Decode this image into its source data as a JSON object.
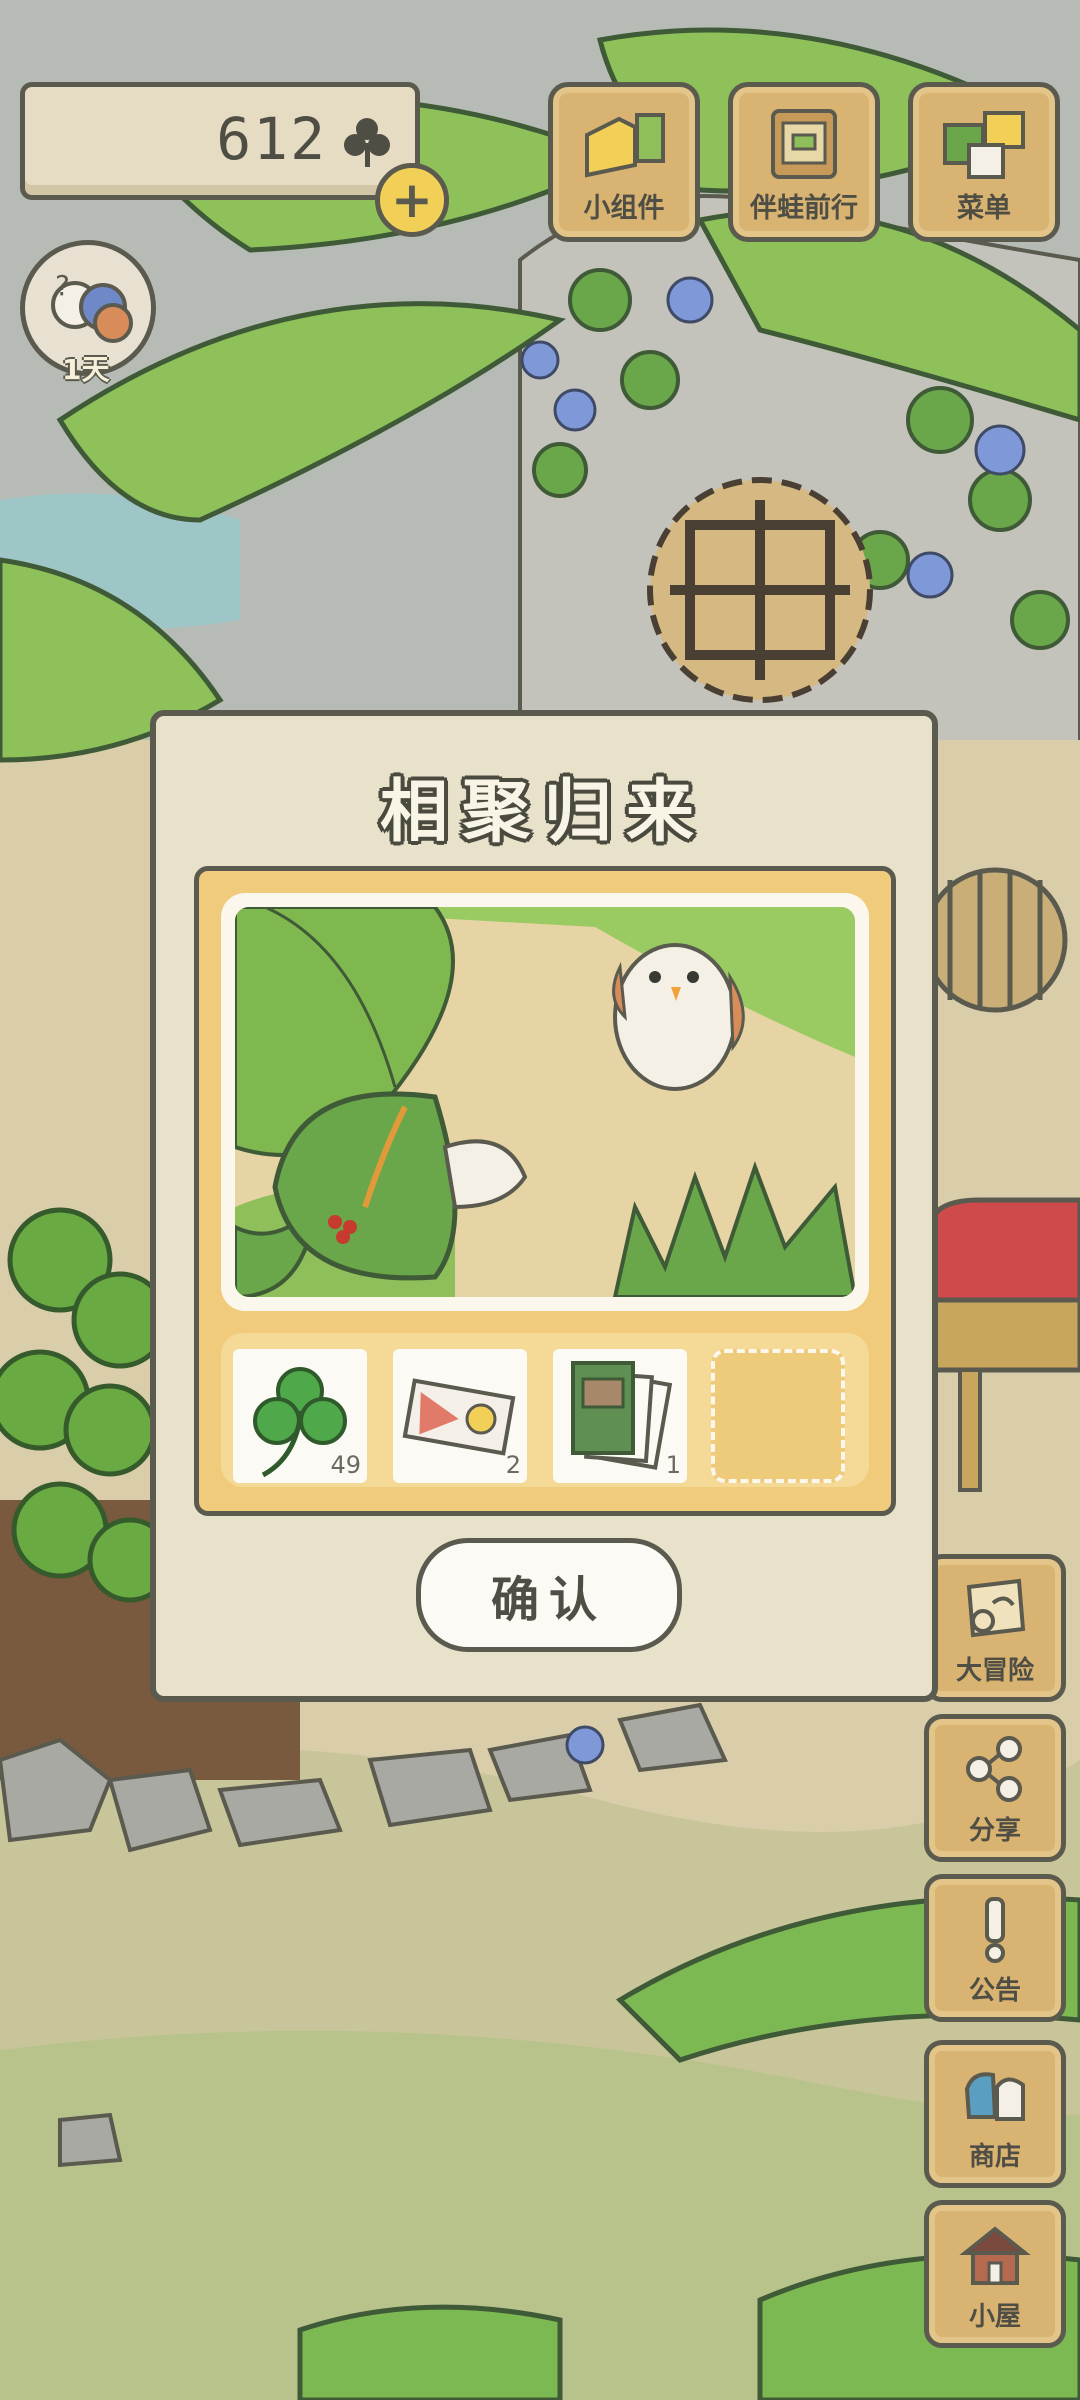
{
  "currency": {
    "count": "612",
    "icon": "clover-icon"
  },
  "album": {
    "day_label": "1天"
  },
  "top_buttons": [
    {
      "label": "小组件",
      "icon": "widget-icon"
    },
    {
      "label": "伴蛙前行",
      "icon": "companion-icon"
    },
    {
      "label": "菜单",
      "icon": "menu-icon"
    }
  ],
  "side_buttons": [
    {
      "label": "大冒险",
      "icon": "adventure-map-icon"
    },
    {
      "label": "分享",
      "icon": "share-icon"
    },
    {
      "label": "公告",
      "icon": "notice-icon"
    },
    {
      "label": "商店",
      "icon": "shop-icon"
    },
    {
      "label": "小屋",
      "icon": "house-icon"
    }
  ],
  "modal": {
    "title": "相聚归来",
    "items": [
      {
        "name": "clover",
        "qty": "49",
        "icon": "clover-icon"
      },
      {
        "name": "ticket",
        "qty": "2",
        "icon": "ticket-icon"
      },
      {
        "name": "cards",
        "qty": "1",
        "icon": "card-icon"
      }
    ],
    "confirm_label": "确认"
  },
  "colors": {
    "outline": "#5a5a4e",
    "wood": "#d9b372",
    "modal_bg": "#e8e2cb",
    "frame": "#f0cb7c",
    "grass": "#8fbf5a"
  }
}
